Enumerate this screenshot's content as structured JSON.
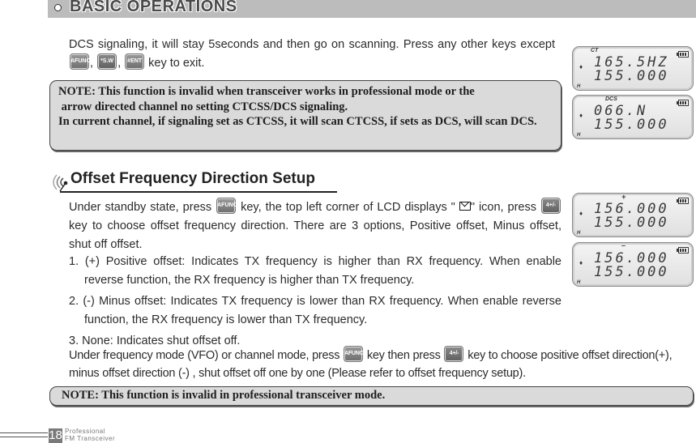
{
  "header": {
    "title": "BASIC OPERATIONS"
  },
  "intro": {
    "text_before_keys": "DCS signaling, it will stay 5seconds and then go on scanning. Press any other keys except ",
    "sep1": ", ",
    "sep2": ", ",
    "text_after_keys": " key to exit."
  },
  "keys": {
    "func": "AFUNC",
    "sw": "*S.W",
    "ent": "#ENT",
    "offset": "4+/-"
  },
  "note1": {
    "line1": "NOTE: This function is invalid when transceiver works in professional mode or the",
    "line2": " arrow directed channel no setting CTCSS/DCS signaling.",
    "line3": "In current channel, if signaling set as CTCSS, it will scan CTCSS, if sets as DCS, will scan DCS."
  },
  "lcd_displays": [
    {
      "top_label": "CT",
      "line1": "165.5HZ",
      "line2": "155.000",
      "corner": "H"
    },
    {
      "top_label": "DCS",
      "line1": "066.N",
      "line2": "155.000",
      "corner": "H"
    },
    {
      "top_label": "+",
      "line1": "156.000",
      "line2": "155.000",
      "corner": "H"
    },
    {
      "top_label": "–",
      "line1": "156.000",
      "line2": "155.000",
      "corner": "H"
    }
  ],
  "section": {
    "title": "Offset Frequency Direction Setup"
  },
  "offset_para": {
    "part1": "Under standby state, press ",
    "part2": " key, the top left corner of LCD displays \" ",
    "part3": "\" icon, press ",
    "part4": " key to choose offset frequency direction. There are 3 options, Positive offset, Minus offset, shut off offset."
  },
  "options": [
    "1. (+) Positive offset: Indicates TX frequency is higher than RX frequency. When enable reverse function, the RX frequency is higher than TX frequency.",
    "2. (-) Minus offset: Indicates TX frequency is lower than RX frequency. When enable reverse function, the RX frequency is lower than TX frequency.",
    "3. None: Indicates shut offset off."
  ],
  "vfo_para": {
    "part1": "Under frequency mode (VFO) or channel mode, press ",
    "part2": " key then press ",
    "part3": " key to choose positive offset direction(+), minus offset direction (-) , shut offset off one by one (Please refer to offset frequency setup)."
  },
  "note2": {
    "text": "NOTE: This function is invalid in professional transceiver mode."
  },
  "footer": {
    "page_number": "18",
    "label_line1": "Professional",
    "label_line2": "FM Transceiver"
  }
}
